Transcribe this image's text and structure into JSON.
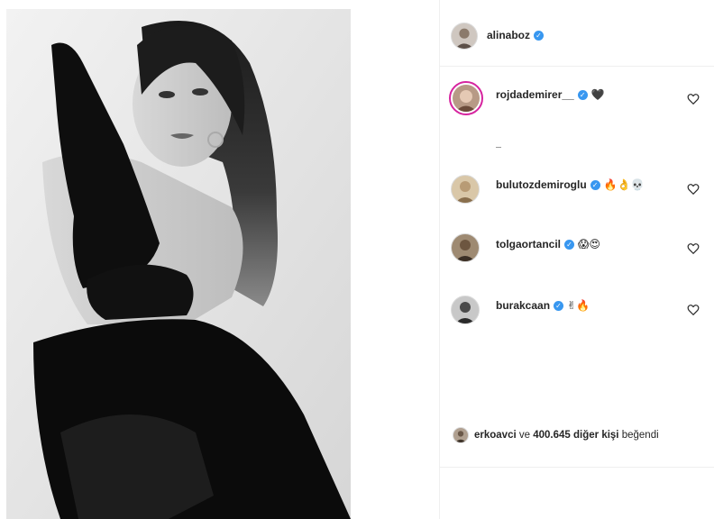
{
  "post": {
    "author": "alinaboz"
  },
  "comments": [
    {
      "username": "rojdademirer__",
      "emoji": "🖤"
    },
    {
      "username": "bulutozdemiroglu",
      "emoji": "🔥👌💀"
    },
    {
      "username": "tolgaortancil",
      "emoji": "😱😍"
    },
    {
      "username": "burakcaan",
      "emoji": "✌🔥"
    }
  ],
  "likes": {
    "first_user": "erkoavci",
    "conjunction": "ve",
    "count_text": "400.645 diğer kişi",
    "suffix": "beğendi"
  },
  "icons": {
    "verified": "verified-badge-icon",
    "like": "heart-outline-icon"
  },
  "colors": {
    "verified_blue": "#3897f0",
    "divider": "#efefef",
    "story_ring": "#d6249f"
  }
}
